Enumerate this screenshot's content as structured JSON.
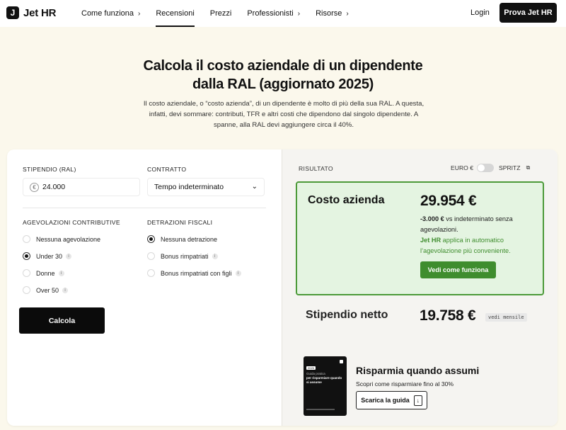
{
  "nav": {
    "logo": "Jet HR",
    "logo_mark": "J",
    "items": [
      {
        "label": "Come funziona",
        "chevron": "›"
      },
      {
        "label": "Recensioni",
        "chevron": ""
      },
      {
        "label": "Prezzi",
        "chevron": ""
      },
      {
        "label": "Professionisti",
        "chevron": "›"
      },
      {
        "label": "Risorse",
        "chevron": "›"
      }
    ],
    "active": "Recensioni",
    "login": "Login",
    "cta": "Prova Jet HR"
  },
  "hero": {
    "title_line1": "Calcola il costo aziendale di un dipendente",
    "title_line2": "dalla RAL (aggiornato 2025)",
    "description": "Il costo aziendale, o “costo azienda”, di un dipendente è molto di più della sua RAL. A questa, infatti, devi sommare: contributi, TFR e altri costi che dipendono dal singolo dipendente. A spanne, alla RAL devi aggiungere circa il 40%."
  },
  "form": {
    "stipendio_label": "STIPENDIO (RAL)",
    "stipendio_value": "24.000",
    "currency_symbol": "€",
    "contratto_label": "CONTRATTO",
    "contratto_value": "Tempo indeterminato",
    "agevolazioni_label": "AGEVOLAZIONI CONTRIBUTIVE",
    "agevolazioni": [
      {
        "label": "Nessuna agevolazione",
        "selected": false,
        "info": false
      },
      {
        "label": "Under 30",
        "selected": true,
        "info": true
      },
      {
        "label": "Donne",
        "selected": false,
        "info": true
      },
      {
        "label": "Over 50",
        "selected": false,
        "info": true
      }
    ],
    "detrazioni_label": "DETRAZIONI FISCALI",
    "detrazioni": [
      {
        "label": "Nessuna detrazione",
        "selected": true,
        "info": false
      },
      {
        "label": "Bonus rimpatriati",
        "selected": false,
        "info": true
      },
      {
        "label": "Bonus rimpatriati con figli",
        "selected": false,
        "info": true
      }
    ],
    "info_glyph": "i",
    "calcola_button": "Calcola"
  },
  "result": {
    "label": "RISULTATO",
    "toggle_left": "EURO €",
    "toggle_right": "SPRITZ",
    "toggle_state": "EURO €",
    "costo_label": "Costo azienda",
    "costo_value": "29.954 €",
    "note_bold": "-3.000 €",
    "note_rest": " vs indeterminato senza agevolazioni.",
    "green_bold": "Jet HR",
    "green_rest": " applica in automatico l’agevolazione più conveniente.",
    "green_button": "Vedi come funziona",
    "netto_label": "Stipendio netto",
    "netto_value": "19.758 €",
    "mensile_badge": "vedi mensile"
  },
  "guide": {
    "book_tag": "2025",
    "book_subtitle": "Guida pratica",
    "book_title": "per risparmiare quando si assume",
    "title": "Risparmia quando assumi",
    "subtitle": "Scopri come risparmiare fino al 30%",
    "button": "Scarica la guida"
  },
  "colors": {
    "background": "#fbf8ec",
    "accent_green": "#3f8d2e",
    "result_box_bg": "#e4f4e1",
    "primary_dark": "#111111"
  }
}
